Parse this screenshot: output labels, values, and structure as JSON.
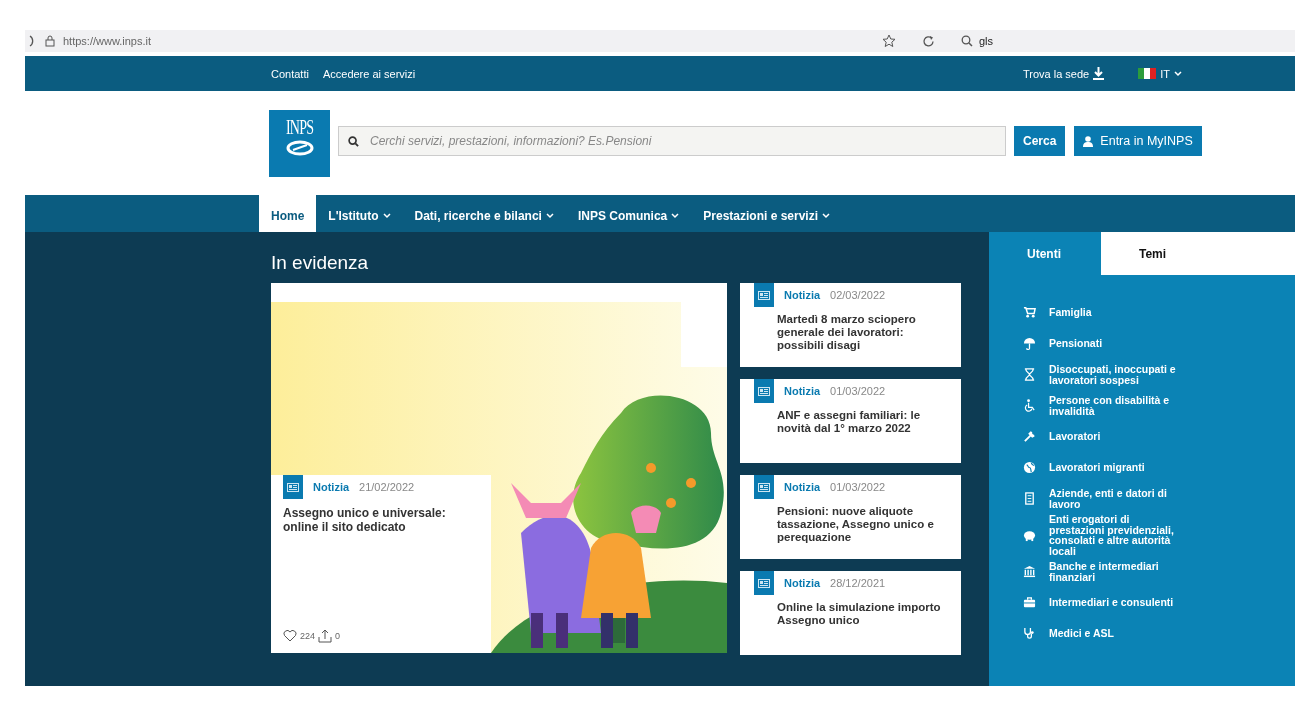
{
  "browser": {
    "url": "https://www.inps.it",
    "search": "gls"
  },
  "top_bar": {
    "links": [
      "Contatti",
      "Accedere ai servizi"
    ],
    "find_office": "Trova la sede",
    "language": "IT"
  },
  "header": {
    "logo": "INPS",
    "search": {
      "placeholder": "Cerchi servizi, prestazioni, informazioni? Es.Pensioni"
    },
    "search_button": "Cerca",
    "login_button": "Entra in MyINPS"
  },
  "nav": [
    {
      "label": "Home",
      "selected": true,
      "dropdown": false
    },
    {
      "label": "L'Istituto",
      "selected": false,
      "dropdown": true
    },
    {
      "label": "Dati, ricerche e bilanci",
      "selected": false,
      "dropdown": true
    },
    {
      "label": "INPS Comunica",
      "selected": false,
      "dropdown": true
    },
    {
      "label": "Prestazioni e servizi",
      "selected": false,
      "dropdown": true
    }
  ],
  "featured": {
    "title": "In evidenza",
    "main": {
      "category": "Notizia",
      "date": "21/02/2022",
      "headline": "Assegno unico e universale: online il sito dedicato",
      "likes": "224",
      "shares": "0"
    },
    "news": [
      {
        "category": "Notizia",
        "date": "02/03/2022",
        "headline": "Martedì 8 marzo sciopero generale dei lavoratori: possibili disagi"
      },
      {
        "category": "Notizia",
        "date": "01/03/2022",
        "headline": "ANF e assegni familiari: le novità dal 1° marzo 2022"
      },
      {
        "category": "Notizia",
        "date": "01/03/2022",
        "headline": "Pensioni: nuove aliquote tassazione, Assegno unico e perequazione"
      },
      {
        "category": "Notizia",
        "date": "28/12/2021",
        "headline": "Online la simulazione importo Assegno unico"
      }
    ]
  },
  "sidebar": {
    "tabs": [
      {
        "label": "Utenti",
        "selected": true
      },
      {
        "label": "Temi",
        "selected": false
      }
    ],
    "items": [
      "Famiglia",
      "Pensionati",
      "Disoccupati, inoccupati e lavoratori sospesi",
      "Persone con disabilità e invalidità",
      "Lavoratori",
      "Lavoratori migranti",
      "Aziende, enti e datori di lavoro",
      "Enti erogatori di prestazioni previdenziali, consolati e altre autorità locali",
      "Banche e intermediari finanziari",
      "Intermediari e consulenti",
      "Medici e ASL"
    ]
  }
}
